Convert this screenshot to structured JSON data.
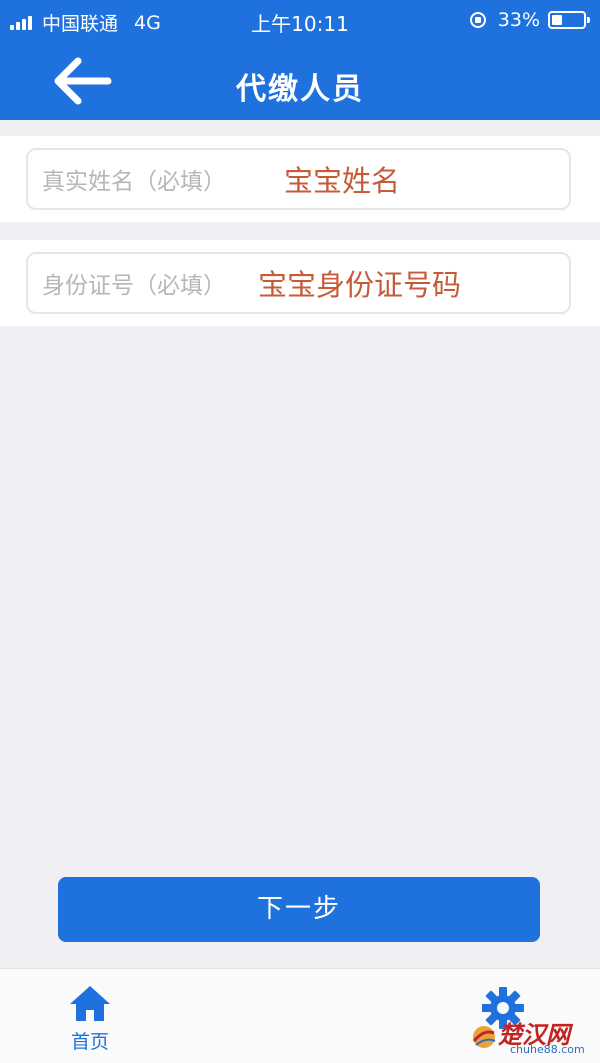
{
  "status_bar": {
    "carrier": "中国联通",
    "network": "4G",
    "time": "上午10:11",
    "battery": "33%"
  },
  "nav": {
    "title": "代缴人员",
    "back_icon": "arrow-left-icon"
  },
  "form": {
    "fields": [
      {
        "label": "真实姓名（必填）",
        "hint": "宝宝姓名"
      },
      {
        "label": "身份证号（必填）",
        "hint": "宝宝身份证号码"
      }
    ]
  },
  "next_button": {
    "label": "下一步"
  },
  "tab_bar": {
    "home": {
      "label": "首页",
      "icon": "home-icon"
    },
    "settings": {
      "icon": "gear-icon"
    }
  },
  "watermark": {
    "text": "楚汉网",
    "sub": "chuhe88.com"
  },
  "colors": {
    "primary": "#1f72dd",
    "hint": "#c55b38",
    "label": "#b6b6bb",
    "background": "#efeff4"
  }
}
